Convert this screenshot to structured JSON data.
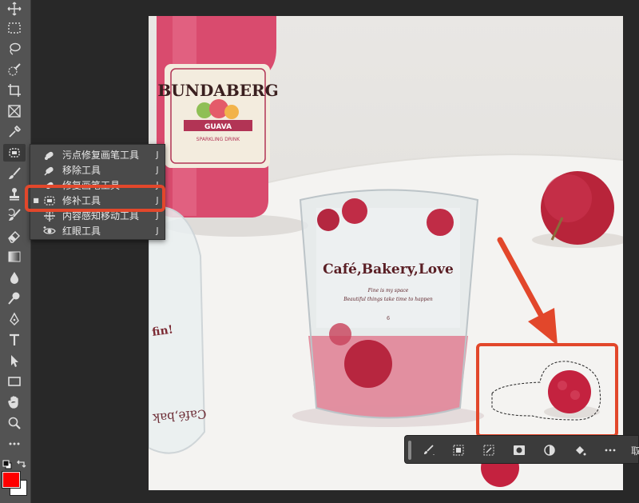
{
  "toolbar": {
    "tools": [
      "move",
      "marquee",
      "lasso",
      "quick-select",
      "crop",
      "frame",
      "eyedropper",
      "healing",
      "brush",
      "stamp",
      "history-brush",
      "eraser",
      "gradient",
      "blur",
      "dodge",
      "pen",
      "type",
      "path-select",
      "rectangle",
      "hand",
      "zoom",
      "more"
    ]
  },
  "flyout": {
    "items": [
      {
        "label": "污点修复画笔工具",
        "key": "J",
        "icon": "spot-healing-icon",
        "selected": false
      },
      {
        "label": "移除工具",
        "key": "J",
        "icon": "remove-tool-icon",
        "selected": false
      },
      {
        "label": "修复画笔工具",
        "key": "J",
        "icon": "healing-brush-icon",
        "selected": false
      },
      {
        "label": "修补工具",
        "key": "J",
        "icon": "patch-tool-icon",
        "selected": true
      },
      {
        "label": "内容感知移动工具",
        "key": "J",
        "icon": "content-aware-move-icon",
        "selected": false
      },
      {
        "label": "红眼工具",
        "key": "J",
        "icon": "red-eye-icon",
        "selected": false
      }
    ]
  },
  "photo": {
    "bottle_brand": "BUNDABERG",
    "bottle_flavor": "GUAVA",
    "bottle_subtitle": "SPARKLING DRINK",
    "glass_text": "Café,Bakery,Love",
    "glass_script_1": "Fine is my space",
    "glass_script_2": "Beautiful things take time to happen",
    "glass_number": "6",
    "tipped_glass_text": "Café,bak"
  },
  "contextbar": {
    "tail_label": "取"
  },
  "colors": {
    "foreground": "#ff0000",
    "background": "#ffffff",
    "annotation": "#e2472b"
  }
}
